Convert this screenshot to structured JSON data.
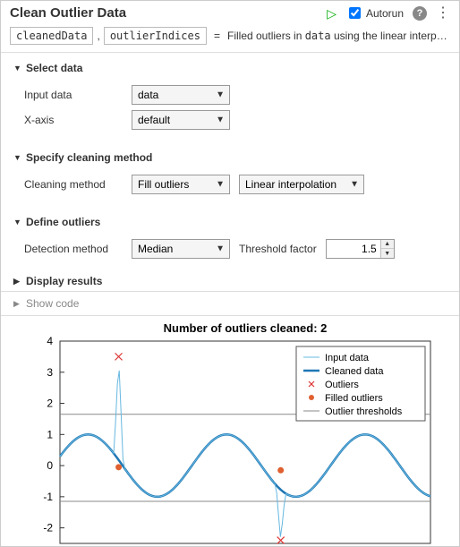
{
  "header": {
    "title": "Clean Outlier Data",
    "autorun_label": "Autorun",
    "autorun_checked": true,
    "run_glyph": "▷"
  },
  "output": {
    "var1": "cleanedData",
    "var2": "outlierIndices",
    "desc_pre": "Filled outliers in ",
    "desc_var": "data",
    "desc_post": " using the linear interpol…"
  },
  "sections": {
    "select_data": {
      "title": "Select data",
      "input_label": "Input data",
      "input_value": "data",
      "xaxis_label": "X-axis",
      "xaxis_value": "default"
    },
    "cleaning": {
      "title": "Specify cleaning method",
      "method_label": "Cleaning method",
      "method_value": "Fill outliers",
      "fill_value": "Linear interpolation"
    },
    "outliers": {
      "title": "Define outliers",
      "detect_label": "Detection method",
      "detect_value": "Median",
      "thresh_label": "Threshold factor",
      "thresh_value": "1.5"
    },
    "display": {
      "title": "Display results"
    },
    "showcode": "Show code"
  },
  "chart_data": {
    "type": "line",
    "title": "Number of outliers cleaned: 2",
    "xlim": [
      0,
      12
    ],
    "ylim": [
      -2.5,
      4
    ],
    "thresholds": [
      1.65,
      -1.15
    ],
    "outliers_x": [
      1.9,
      7.15
    ],
    "outliers_y": [
      3.5,
      -2.4
    ],
    "filled_x": [
      1.9,
      7.15
    ],
    "filled_y": [
      -0.05,
      -0.15
    ],
    "xlabel": "",
    "ylabel": "",
    "series": [
      {
        "name": "Input data"
      },
      {
        "name": "Cleaned data"
      },
      {
        "name": "Outliers"
      },
      {
        "name": "Filled outliers"
      },
      {
        "name": "Outlier thresholds"
      }
    ]
  }
}
